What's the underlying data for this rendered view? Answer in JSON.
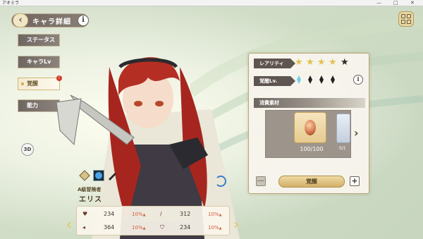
{
  "window": {
    "title": "アオミラ",
    "controls": [
      "—",
      "□",
      "✕"
    ]
  },
  "header": {
    "back_icon": "arrow-left-icon",
    "title": "キャラ詳細",
    "info": "i"
  },
  "menu_icon": "grid-menu-icon",
  "side_nav": [
    {
      "label": "ステータス",
      "active": false
    },
    {
      "label": "キャラLv",
      "active": false
    },
    {
      "label": "覚醒",
      "active": true
    },
    {
      "label": "能力",
      "active": false
    }
  ],
  "side_badge": "!",
  "view_3d": "3D",
  "character": {
    "title": "A級冒険者",
    "name": "エリス"
  },
  "stats": [
    {
      "icon": "heart-icon",
      "value": "234",
      "pct": "10%"
    },
    {
      "icon": "sword-icon",
      "value": "312",
      "pct": "10%"
    },
    {
      "icon": "speed-icon",
      "value": "364",
      "pct": "10%"
    },
    {
      "icon": "shield-icon",
      "value": "234",
      "pct": "10%"
    }
  ],
  "panel": {
    "rarity_label": "レアリティ",
    "rarity_filled": 4,
    "rarity_max": 5,
    "awaken_label": "覚醒Lv.",
    "awaken_level": 1,
    "awaken_max": 4,
    "info": "i",
    "materials_title": "消費素材",
    "material_count": "100/100",
    "material_count2": "0/1",
    "awaken_button": "覚醒",
    "minus": "—",
    "plus": "+"
  },
  "colors": {
    "accent_gold": "#d3b06a",
    "dark_label": "#5f5550",
    "highlight_red": "#d35a3b",
    "gem_active": "#6fd0e8"
  }
}
